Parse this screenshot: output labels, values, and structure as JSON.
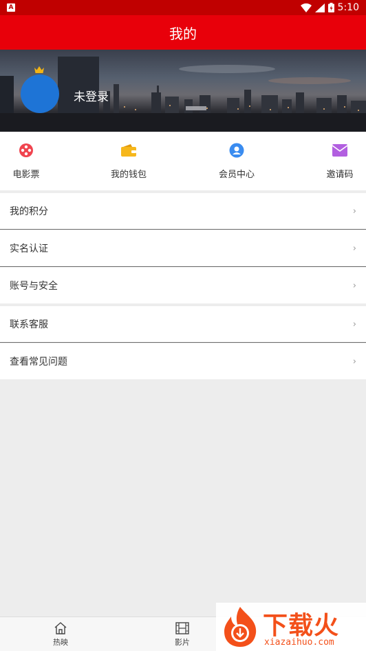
{
  "status_bar": {
    "time": "5:10",
    "app_badge": "A"
  },
  "header": {
    "title": "我的"
  },
  "profile": {
    "login_status": "未登录"
  },
  "quick_actions": [
    {
      "label": "电影票",
      "icon": "film-reel-icon",
      "color": "#f0444f"
    },
    {
      "label": "我的钱包",
      "icon": "wallet-icon",
      "color": "#f6b71b"
    },
    {
      "label": "会员中心",
      "icon": "member-icon",
      "color": "#3a8cf0"
    },
    {
      "label": "邀请码",
      "icon": "invite-mail-icon",
      "color": "#b25fe0"
    }
  ],
  "menu": [
    {
      "label": "我的积分",
      "arrow": "›"
    },
    {
      "label": "实名认证",
      "arrow": "›"
    },
    {
      "label": "账号与安全",
      "arrow": "›"
    },
    {
      "label": "联系客服",
      "arrow": "›"
    },
    {
      "label": "查看常见问题",
      "arrow": "›"
    }
  ],
  "tabs": [
    {
      "label": "热映",
      "icon": "home-icon"
    },
    {
      "label": "影片",
      "icon": "film-strip-icon"
    }
  ],
  "watermark": {
    "text": "下载火",
    "domain": "xiazaihuo.com"
  },
  "colors": {
    "primary_red": "#e8000a",
    "avatar_blue": "#1e74d6"
  }
}
